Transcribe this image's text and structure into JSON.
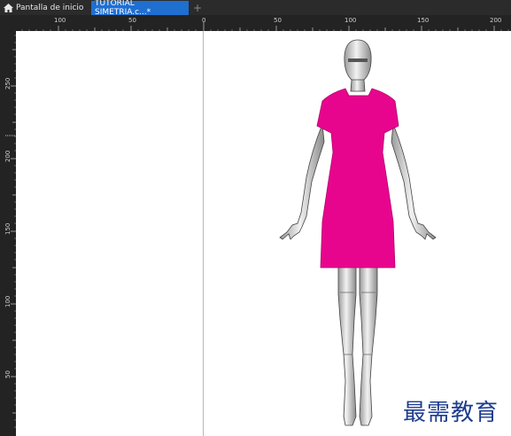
{
  "tabs": {
    "home_label": "Pantalla de inicio",
    "document_label": "TUTORIAL SIMETRIA.c...*",
    "new_tab_symbol": "+"
  },
  "rulers": {
    "top_labels": [
      "100",
      "50",
      "0",
      "50",
      "100",
      "150",
      "200"
    ],
    "left_labels": [
      "250",
      "200",
      "150",
      "100",
      "50"
    ]
  },
  "colors": {
    "dress": "#e8058e",
    "active_tab": "#1f6fd1"
  },
  "watermark": "最需教育"
}
